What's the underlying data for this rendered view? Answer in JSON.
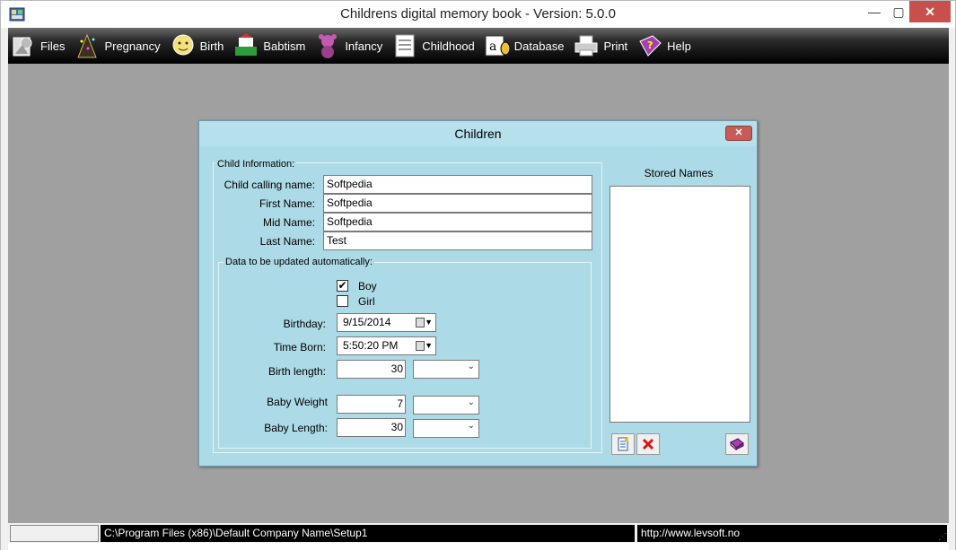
{
  "window": {
    "title": "Childrens digital memory book -  Version: 5.0.0",
    "min_glyph": "—",
    "max_glyph": "▢",
    "close_glyph": "✕"
  },
  "toolbar": {
    "items": [
      {
        "label": "Files",
        "icon": "files-icon"
      },
      {
        "label": "Pregnancy",
        "icon": "pregnancy-icon"
      },
      {
        "label": "Birth",
        "icon": "birth-icon"
      },
      {
        "label": "Babtism",
        "icon": "babtism-icon"
      },
      {
        "label": "Infancy",
        "icon": "infancy-icon"
      },
      {
        "label": "Childhood",
        "icon": "childhood-icon"
      },
      {
        "label": "Database",
        "icon": "database-icon"
      },
      {
        "label": "Print",
        "icon": "print-icon"
      },
      {
        "label": "Help",
        "icon": "help-icon"
      }
    ]
  },
  "dialog": {
    "title": "Children",
    "close_glyph": "✕",
    "child_info": {
      "group_label": "Child Information:",
      "calling_name_label": "Child calling name:",
      "calling_name_value": "Softpedia",
      "first_name_label": "First Name:",
      "first_name_value": "Softpedia",
      "mid_name_label": "Mid Name:",
      "mid_name_value": "Softpedia",
      "last_name_label": "Last Name:",
      "last_name_value": "Test"
    },
    "auto": {
      "group_label": "Data to be updated automatically:",
      "boy_label": "Boy",
      "boy_checked": true,
      "check_glyph": "✔",
      "girl_label": "Girl",
      "girl_checked": false,
      "birthday_label": "Birthday:",
      "birthday_value": "9/15/2014",
      "time_born_label": "Time Born:",
      "time_born_value": "5:50:20 PM",
      "birth_length_label": "Birth length:",
      "birth_length_value": "30",
      "baby_weight_label": "Baby Weight",
      "baby_weight_value": "7",
      "baby_length_label": "Baby Length:",
      "baby_length_value": "30"
    },
    "stored": {
      "title": "Stored Names",
      "items": []
    }
  },
  "status": {
    "left": "",
    "path": "C:\\Program Files (x86)\\Default Company Name\\Setup1",
    "url": "http://www.levsoft.no"
  }
}
